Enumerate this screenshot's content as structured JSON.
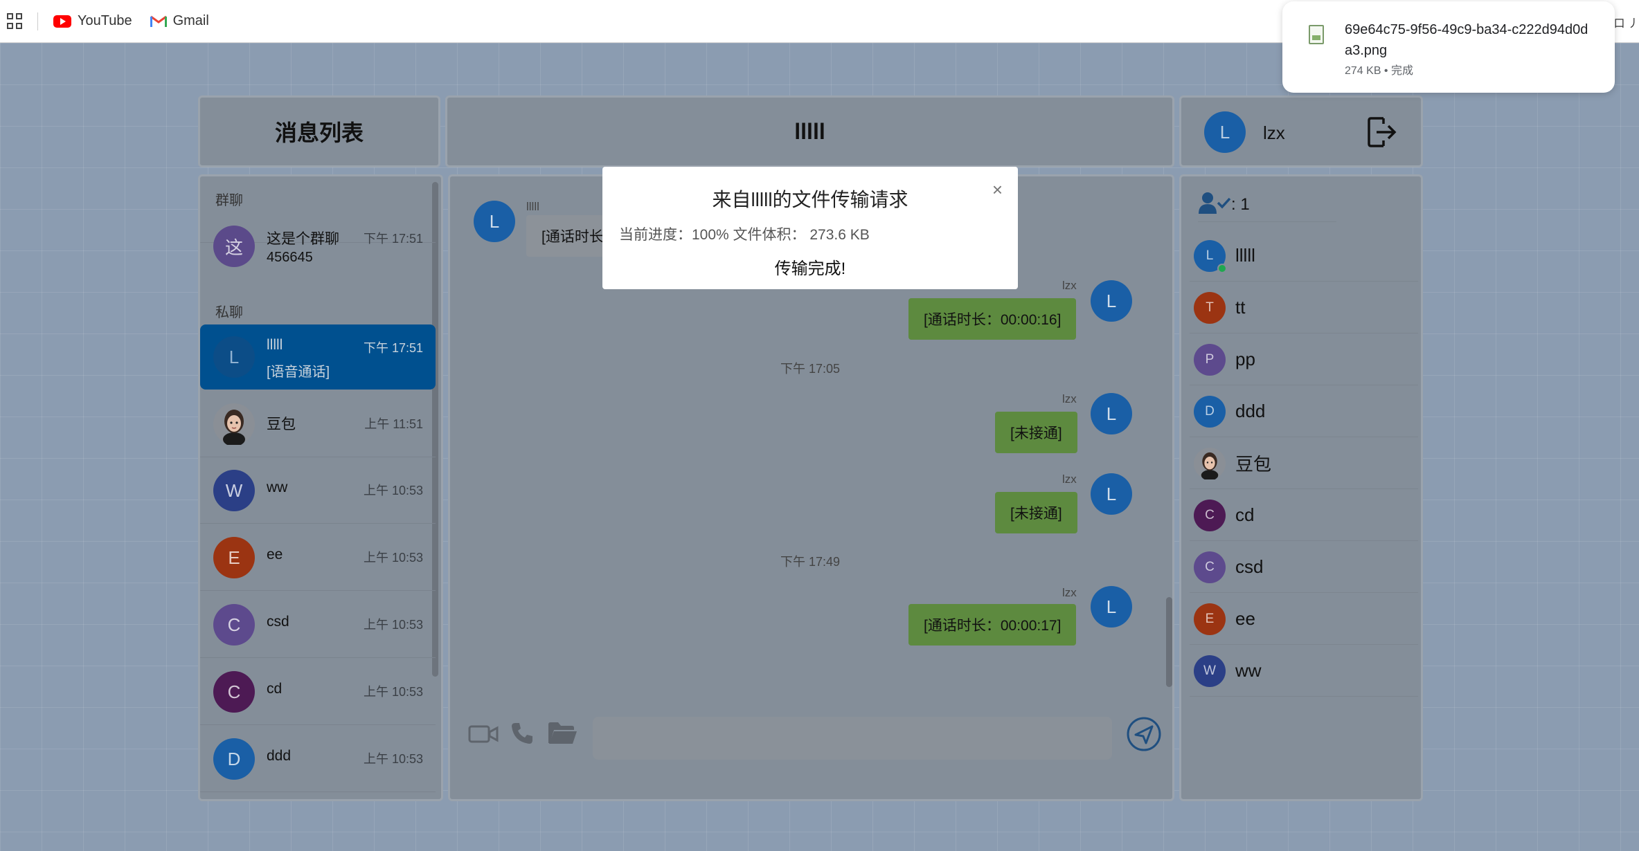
{
  "bookmarks": [
    {
      "label": "YouTube",
      "icon": "youtube-icon"
    },
    {
      "label": "Gmail",
      "icon": "gmail-icon"
    }
  ],
  "download": {
    "filename": "69e64c75-9f56-49c9-ba34-c222d94d0da3.png",
    "meta": "274 KB • 完成",
    "edge_text": "口 丿"
  },
  "left_panel": {
    "title": "消息列表",
    "group_label": "群聊",
    "private_label": "私聊",
    "groups": [
      {
        "avatar": "这",
        "name": "这是个群聊",
        "sub": "456645",
        "time": "下午 17:51",
        "color": "#5b4a8a"
      }
    ],
    "chats": [
      {
        "avatar": "L",
        "name": "lllll",
        "sub": "[语音通话]",
        "time": "下午 17:51",
        "color": "#0c4d87",
        "active": true
      },
      {
        "avatar": "",
        "name": "豆包",
        "sub": "",
        "time": "上午 11:51",
        "color": "#8a8f96",
        "active": false
      },
      {
        "avatar": "W",
        "name": "ww",
        "sub": "",
        "time": "上午 10:53",
        "color": "#2b3f86",
        "active": false
      },
      {
        "avatar": "E",
        "name": "ee",
        "sub": "",
        "time": "上午 10:53",
        "color": "#9b3412",
        "active": false
      },
      {
        "avatar": "C",
        "name": "csd",
        "sub": "",
        "time": "上午 10:53",
        "color": "#5d4a8d",
        "active": false
      },
      {
        "avatar": "C",
        "name": "cd",
        "sub": "",
        "time": "上午 10:53",
        "color": "#4d1a54",
        "active": false
      },
      {
        "avatar": "D",
        "name": "ddd",
        "sub": "",
        "time": "上午 10:53",
        "color": "#1a5fa6",
        "active": false
      }
    ]
  },
  "chat": {
    "title": "lllll",
    "messages": [
      {
        "side": "theirs",
        "avatar": "L",
        "sender": "lllll",
        "text": "[通话时长"
      },
      {
        "side": "mine",
        "avatar": "L",
        "sender": "lzx",
        "text": "[通话时长：00:00:16]"
      },
      {
        "type": "time",
        "text": "下午 17:05"
      },
      {
        "side": "mine",
        "avatar": "L",
        "sender": "lzx",
        "text": "[未接通]"
      },
      {
        "side": "mine",
        "avatar": "L",
        "sender": "lzx",
        "text": "[未接通]"
      },
      {
        "type": "time",
        "text": "下午 17:49"
      },
      {
        "side": "mine",
        "avatar": "L",
        "sender": "lzx",
        "text": "[通话时长：00:00:17]"
      }
    ],
    "input_placeholder": ""
  },
  "right_panel": {
    "user_avatar": "L",
    "user_name": "lzx",
    "online_count": ": 1",
    "users": [
      {
        "avatar": "L",
        "name": "lllll",
        "color": "#1a5fa6",
        "online": true
      },
      {
        "avatar": "T",
        "name": "tt",
        "color": "#9b3412",
        "online": false
      },
      {
        "avatar": "P",
        "name": "pp",
        "color": "#5d4a8d",
        "online": false
      },
      {
        "avatar": "D",
        "name": "ddd",
        "color": "#1a5fa6",
        "online": false
      },
      {
        "avatar": "",
        "name": "豆包",
        "color": "#8a8f96",
        "online": false
      },
      {
        "avatar": "C",
        "name": "cd",
        "color": "#4d1a54",
        "online": false
      },
      {
        "avatar": "C",
        "name": "csd",
        "color": "#5d4a8d",
        "online": false
      },
      {
        "avatar": "E",
        "name": "ee",
        "color": "#9b3412",
        "online": false
      },
      {
        "avatar": "W",
        "name": "ww",
        "color": "#2b3f86",
        "online": false
      }
    ]
  },
  "dialog": {
    "title": "来自lllll的文件传输请求",
    "info": "当前进度：100% 文件体积：  273.6 KB",
    "progress_percent": 100,
    "status": "传输完成!",
    "close_glyph": "×"
  }
}
